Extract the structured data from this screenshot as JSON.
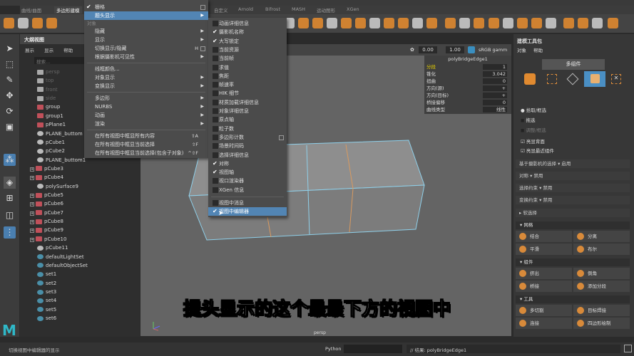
{
  "shelf": {
    "left_tabs": [
      "曲线/曲面",
      "多边形建模"
    ],
    "right_tabs": [
      "自定义",
      "Arnold",
      "Bifrost",
      "MASH",
      "运动图形",
      "XGen"
    ]
  },
  "outliner": {
    "title": "大纲视图",
    "menu": [
      "展示",
      "显示",
      "帮助"
    ],
    "search_placeholder": "搜索...",
    "items": [
      {
        "name": "persp",
        "type": "camera"
      },
      {
        "name": "top",
        "type": "camera"
      },
      {
        "name": "front",
        "type": "camera"
      },
      {
        "name": "side",
        "type": "camera"
      },
      {
        "name": "group",
        "type": "mesh"
      },
      {
        "name": "group1",
        "type": "mesh"
      },
      {
        "name": "pPlane1",
        "type": "mesh"
      },
      {
        "name": "PLANE_buttom",
        "type": "transform"
      },
      {
        "name": "pCube1",
        "type": "transform"
      },
      {
        "name": "pCube2",
        "type": "transform"
      },
      {
        "name": "PLANE_buttom1",
        "type": "transform"
      },
      {
        "name": "pCube3",
        "type": "mesh",
        "expand": true
      },
      {
        "name": "pCube4",
        "type": "mesh",
        "expand": true
      },
      {
        "name": "polySurface9",
        "type": "transform"
      },
      {
        "name": "pCube5",
        "type": "mesh",
        "expand": true
      },
      {
        "name": "pCube6",
        "type": "mesh",
        "expand": true
      },
      {
        "name": "pCube7",
        "type": "mesh",
        "expand": true
      },
      {
        "name": "pCube8",
        "type": "mesh",
        "expand": true
      },
      {
        "name": "pCube9",
        "type": "mesh",
        "expand": true
      },
      {
        "name": "pCube10",
        "type": "mesh",
        "expand": true
      },
      {
        "name": "pCube11",
        "type": "transform"
      },
      {
        "name": "defaultLightSet",
        "type": "set"
      },
      {
        "name": "defaultObjectSet",
        "type": "set"
      },
      {
        "name": "set1",
        "type": "set"
      },
      {
        "name": "set2",
        "type": "set"
      },
      {
        "name": "set3",
        "type": "set"
      },
      {
        "name": "set4",
        "type": "set"
      },
      {
        "name": "set5",
        "type": "set"
      },
      {
        "name": "set6",
        "type": "set"
      }
    ]
  },
  "menu": {
    "items": [
      {
        "label": "栅格",
        "checked": true,
        "option": true
      },
      {
        "label": "题头显示",
        "submenu": true,
        "highlight": true
      },
      {
        "section": "对象"
      },
      {
        "label": "隐藏",
        "submenu": true
      },
      {
        "label": "显示",
        "submenu": true
      },
      {
        "label": "切换显示/隐藏",
        "shortcut": "H",
        "option": true
      },
      {
        "label": "根据摄影机可见性",
        "submenu": true
      },
      {
        "sep": true
      },
      {
        "label": "线框颜色...",
        "submenu": false
      },
      {
        "label": "对象显示",
        "submenu": true
      },
      {
        "label": "变换显示",
        "submenu": true
      },
      {
        "sep": true
      },
      {
        "label": "多边形",
        "submenu": true
      },
      {
        "label": "NURBS",
        "submenu": true
      },
      {
        "label": "动画",
        "submenu": true
      },
      {
        "label": "渲染",
        "submenu": true
      },
      {
        "sep": true
      },
      {
        "label": "在所有视图中框显所有内容",
        "shortcut": "⇧A"
      },
      {
        "label": "在所有视图中框显当前选择",
        "shortcut": "⇧F"
      },
      {
        "label": "在所有视图中框显当前选择(包含子对象)",
        "shortcut": "^⇧F"
      }
    ]
  },
  "submenu": {
    "items": [
      {
        "label": "动画详细信息",
        "checked": false
      },
      {
        "label": "摄影机名称",
        "checked": true
      },
      {
        "label": "大写锁定",
        "checked": true
      },
      {
        "label": "当前资源",
        "checked": false
      },
      {
        "label": "当前帧",
        "checked": false
      },
      {
        "label": "求值",
        "checked": false
      },
      {
        "label": "焦距",
        "checked": false
      },
      {
        "label": "帧速率",
        "checked": false
      },
      {
        "label": "HIK 细节",
        "checked": false
      },
      {
        "label": "材质加载详细信息",
        "checked": false
      },
      {
        "label": "对象详细信息",
        "checked": false
      },
      {
        "label": "原点轴",
        "checked": false
      },
      {
        "label": "粒子数",
        "checked": false
      },
      {
        "label": "多边形计数",
        "checked": false,
        "option": true
      },
      {
        "label": "场景时间码",
        "checked": false
      },
      {
        "label": "选择详细信息",
        "checked": false
      },
      {
        "label": "对称",
        "checked": true
      },
      {
        "label": "视图轴",
        "checked": true
      },
      {
        "label": "视口渲染器",
        "checked": false
      },
      {
        "label": "XGen 信息",
        "checked": false
      },
      {
        "sep": true
      },
      {
        "label": "视图中消息",
        "checked": false
      },
      {
        "label": "视图中编辑器",
        "checked": true,
        "highlight": true
      }
    ]
  },
  "viewport": {
    "exposure": "0.00",
    "gamma": "1.00",
    "colorspace": "sRGB gamm",
    "camera_label": "persp"
  },
  "channel_box": {
    "title": "polyBridgeEdge1",
    "rows": [
      {
        "label": "分段",
        "value": "1"
      },
      {
        "label": "锥化",
        "value": "3.042"
      },
      {
        "label": "扭曲",
        "value": "0"
      },
      {
        "label": "方向(源)",
        "value": "+"
      },
      {
        "label": "方向(目标)",
        "value": "+"
      },
      {
        "label": "桥接偏移",
        "value": "0"
      },
      {
        "label": "曲线类型",
        "value": "线性"
      }
    ]
  },
  "toolkit": {
    "title": "建模工具包",
    "menu": [
      "对象",
      "帮助"
    ],
    "mode_button": "多组件",
    "radios": [
      "拾取/框选",
      "拖选",
      "调整/框选"
    ],
    "checkboxes": [
      "亮显背面",
      "亮显最近组件"
    ],
    "rows": [
      {
        "label": "基于摄影机的选择",
        "value": "启用"
      },
      {
        "label": "对称",
        "value": "禁用"
      },
      {
        "label": "选择约束",
        "value": "禁用"
      },
      {
        "label": "变换约束",
        "value": "禁用"
      }
    ],
    "soft_select": "软选择",
    "sections": [
      {
        "title": "网格",
        "buttons": [
          "结合",
          "分离",
          "平滑",
          "布尔"
        ]
      },
      {
        "title": "组件",
        "buttons": [
          "挤出",
          "倒角",
          "桥接",
          "添加分段"
        ]
      },
      {
        "title": "工具",
        "buttons": [
          "多切割",
          "目标焊接",
          "连接",
          "四边形绘制"
        ]
      }
    ]
  },
  "status": {
    "help_text": "切换视图中编辑器的显示",
    "lang": "Python",
    "result": "// 结果: polyBridgeEdge1"
  },
  "subtitle": "提头显示的这个最最下方的视图中",
  "colors": {
    "accent": "#5285b4",
    "orange": "#e08a30",
    "selection": "#8fd0ea"
  }
}
